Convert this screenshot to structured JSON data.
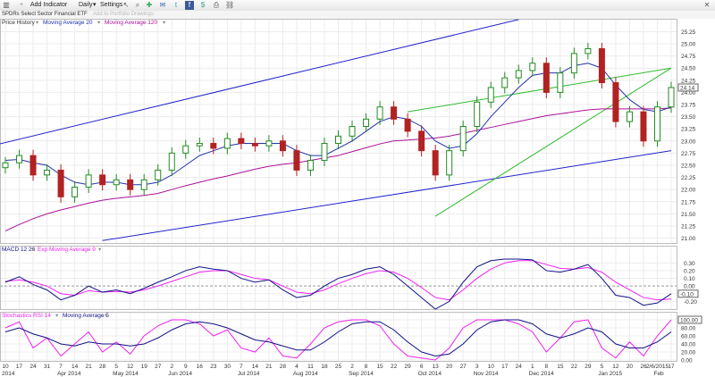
{
  "toolbar": {
    "add_indicator": "Add Indicator",
    "period": "Daily",
    "settings": "Settings",
    "icons": [
      "chart-type-icon",
      "cursor-icon",
      "search-icon",
      "crosshair-icon",
      "email-icon",
      "twitter-icon",
      "facebook-icon",
      "stocktwits-icon",
      "print-icon",
      "link-icon",
      "close-icon"
    ]
  },
  "title": {
    "symbol": "SPDRs Select Sector Financial ETF",
    "faint": "Add to Portfolio   Drawings"
  },
  "legend_main": {
    "price": "Price History",
    "ma20": "Moving Average 20",
    "ma120": "Moving Average 120"
  },
  "legend_macd": {
    "macd": "MACD 12 26",
    "ema": "Exp Moving Average 9"
  },
  "legend_stoch": {
    "stoch": "Stochastics RSI 14",
    "ma": "Moving Average 5"
  },
  "colors": {
    "up": "#228b22",
    "down": "#b22222",
    "ma20": "#2233aa",
    "ma120": "#aa1199",
    "channel_outer": "#2222cc",
    "channel_inner": "#33bb33",
    "macd": "#111188",
    "signal": "#ee22ee"
  },
  "chart_data": [
    {
      "type": "candlestick",
      "title": "SPDRs Select Sector Financial ETF",
      "x": [
        "Mar 10",
        "Mar 17",
        "Mar 24",
        "Mar 31",
        "Apr 7",
        "Apr 14",
        "Apr 21",
        "Apr 28",
        "May 5",
        "May 12",
        "May 19",
        "May 26",
        "Jun 2",
        "Jun 9",
        "Jun 16",
        "Jun 23",
        "Jun 30",
        "Jul 7",
        "Jul 14",
        "Jul 21",
        "Jul 28",
        "Aug 4",
        "Aug 11",
        "Aug 18",
        "Aug 25",
        "Sep 1",
        "Sep 8",
        "Sep 15",
        "Sep 22",
        "Sep 29",
        "Oct 6",
        "Oct 13",
        "Oct 20",
        "Oct 27",
        "Nov 3",
        "Nov 10",
        "Nov 17",
        "Nov 24",
        "Dec 1",
        "Dec 8",
        "Dec 15",
        "Dec 22",
        "Dec 29",
        "Jan 5",
        "Jan 12",
        "Jan 19",
        "Jan 26",
        "Feb 2",
        "Feb 6"
      ],
      "close": [
        22.55,
        22.7,
        22.3,
        22.4,
        21.85,
        22.05,
        22.3,
        22.1,
        22.2,
        22.0,
        22.2,
        22.4,
        22.75,
        22.9,
        22.95,
        22.85,
        23.05,
        22.95,
        22.9,
        23.0,
        22.8,
        22.4,
        22.6,
        22.95,
        23.1,
        23.3,
        23.45,
        23.7,
        23.45,
        23.2,
        22.8,
        22.3,
        22.8,
        23.3,
        23.8,
        24.1,
        24.3,
        24.45,
        24.6,
        24.0,
        24.4,
        24.8,
        24.9,
        24.2,
        23.4,
        23.6,
        23.0,
        23.7,
        24.1
      ],
      "ma20": [
        22.6,
        22.62,
        22.55,
        22.5,
        22.3,
        22.15,
        22.1,
        22.15,
        22.15,
        22.1,
        22.1,
        22.15,
        22.3,
        22.5,
        22.7,
        22.8,
        22.9,
        22.95,
        22.95,
        22.95,
        22.95,
        22.8,
        22.7,
        22.7,
        22.85,
        23.0,
        23.2,
        23.4,
        23.5,
        23.45,
        23.3,
        23.0,
        22.85,
        22.9,
        23.15,
        23.5,
        23.8,
        24.1,
        24.35,
        24.4,
        24.4,
        24.55,
        24.6,
        24.5,
        24.15,
        23.85,
        23.65,
        23.6,
        23.7
      ],
      "ma120": [
        21.15,
        21.28,
        21.4,
        21.5,
        21.58,
        21.65,
        21.72,
        21.78,
        21.82,
        21.85,
        21.88,
        21.92,
        22.0,
        22.08,
        22.15,
        22.22,
        22.28,
        22.35,
        22.42,
        22.48,
        22.52,
        22.55,
        22.6,
        22.65,
        22.7,
        22.78,
        22.86,
        22.94,
        23.0,
        23.02,
        23.04,
        23.06,
        23.1,
        23.16,
        23.22,
        23.28,
        23.34,
        23.4,
        23.46,
        23.52,
        23.56,
        23.6,
        23.64,
        23.66,
        23.66,
        23.66,
        23.66,
        23.66,
        23.68
      ],
      "ylim": [
        20.9,
        25.35
      ],
      "yticks": [
        "25.25",
        "25.00",
        "24.75",
        "24.50",
        "24.25",
        "24.00",
        "23.75",
        "23.50",
        "23.25",
        "23.00",
        "22.75",
        "22.50",
        "22.25",
        "22.00",
        "21.75",
        "21.50",
        "21.25",
        "21.00"
      ],
      "last_label": "24.14",
      "channels": {
        "outer_upper": [
          [
            "Feb 24",
            22.9
          ],
          [
            "Nov 24",
            25.5
          ]
        ],
        "outer_lower": [
          [
            "Apr 28",
            20.95
          ],
          [
            "Feb 6",
            22.8
          ]
        ],
        "inner_upper": [
          [
            "Sep 29",
            23.6
          ],
          [
            "Feb 6",
            24.5
          ]
        ],
        "inner_lower": [
          [
            "Oct 13",
            21.45
          ],
          [
            "Feb 6",
            24.5
          ]
        ]
      }
    },
    {
      "type": "line",
      "title": "MACD 12 26",
      "series": [
        {
          "name": "MACD 12 26",
          "values": [
            0.05,
            0.12,
            0.02,
            -0.05,
            -0.18,
            -0.12,
            0.0,
            -0.08,
            -0.05,
            -0.1,
            -0.03,
            0.05,
            0.12,
            0.2,
            0.25,
            0.22,
            0.2,
            0.1,
            0.05,
            0.08,
            -0.05,
            -0.15,
            -0.12,
            0.0,
            0.1,
            0.15,
            0.22,
            0.25,
            0.15,
            0.0,
            -0.15,
            -0.3,
            -0.2,
            0.05,
            0.25,
            0.33,
            0.35,
            0.35,
            0.34,
            0.2,
            0.18,
            0.22,
            0.28,
            0.1,
            -0.12,
            -0.15,
            -0.25,
            -0.22,
            -0.1
          ]
        },
        {
          "name": "Exp Moving Average 9",
          "values": [
            0.06,
            0.08,
            0.05,
            0.0,
            -0.1,
            -0.12,
            -0.06,
            -0.08,
            -0.07,
            -0.08,
            -0.05,
            0.0,
            0.06,
            0.12,
            0.18,
            0.2,
            0.2,
            0.15,
            0.1,
            0.08,
            0.0,
            -0.08,
            -0.1,
            -0.05,
            0.03,
            0.1,
            0.16,
            0.2,
            0.18,
            0.1,
            -0.02,
            -0.15,
            -0.18,
            -0.05,
            0.1,
            0.22,
            0.3,
            0.33,
            0.33,
            0.28,
            0.23,
            0.22,
            0.24,
            0.18,
            0.05,
            -0.05,
            -0.15,
            -0.18,
            -0.17
          ]
        }
      ],
      "ylim": [
        -0.3,
        0.42
      ],
      "yticks": [
        "0.30",
        "0.20",
        "0.10",
        "0.00",
        "-0.10",
        "-0.20"
      ],
      "last_label": "-0.10"
    },
    {
      "type": "line",
      "title": "Stochastics RSI 14",
      "series": [
        {
          "name": "Stochastics RSI 14",
          "values": [
            80,
            95,
            30,
            55,
            10,
            40,
            70,
            20,
            45,
            15,
            60,
            85,
            100,
            100,
            90,
            60,
            75,
            30,
            20,
            55,
            10,
            5,
            40,
            80,
            95,
            100,
            100,
            85,
            40,
            10,
            5,
            0,
            30,
            80,
            100,
            100,
            100,
            90,
            70,
            20,
            55,
            95,
            100,
            30,
            5,
            45,
            10,
            60,
            100
          ]
        },
        {
          "name": "Moving Average 5",
          "values": [
            70,
            80,
            65,
            55,
            40,
            35,
            45,
            40,
            40,
            35,
            40,
            55,
            75,
            90,
            95,
            90,
            80,
            65,
            50,
            45,
            35,
            25,
            25,
            45,
            70,
            90,
            95,
            95,
            75,
            45,
            20,
            10,
            15,
            40,
            75,
            95,
            100,
            100,
            90,
            65,
            55,
            65,
            80,
            70,
            40,
            30,
            30,
            45,
            70
          ]
        }
      ],
      "ylim": [
        0,
        100
      ],
      "yticks": [
        "100.00",
        "80.00",
        "60.00",
        "40.00",
        "20.00",
        "0.00"
      ],
      "last_label": "100.00",
      "x_tick_labels": [
        "10",
        "17",
        "24",
        "31",
        "7",
        "14",
        "21",
        "28",
        "5",
        "12",
        "19",
        "27",
        "2",
        "9",
        "16",
        "23",
        "30",
        "7",
        "14",
        "21",
        "28",
        "4",
        "11",
        "18",
        "25",
        "2",
        "8",
        "15",
        "22",
        "29",
        "6",
        "13",
        "20",
        "27",
        "3",
        "10",
        "17",
        "24",
        "1",
        "8",
        "15",
        "22",
        "29",
        "5",
        "12",
        "20",
        "26",
        "2/6/2015",
        "17"
      ],
      "x_month_labels": [
        "2014",
        "Apr 2014",
        "May 2014",
        "Jun 2014",
        "Jul 2014",
        "Aug 2014",
        "Sep 2014",
        "Oct 2014",
        "Nov 2014",
        "Dec 2014",
        "Jan 2015",
        "Feb"
      ]
    }
  ]
}
